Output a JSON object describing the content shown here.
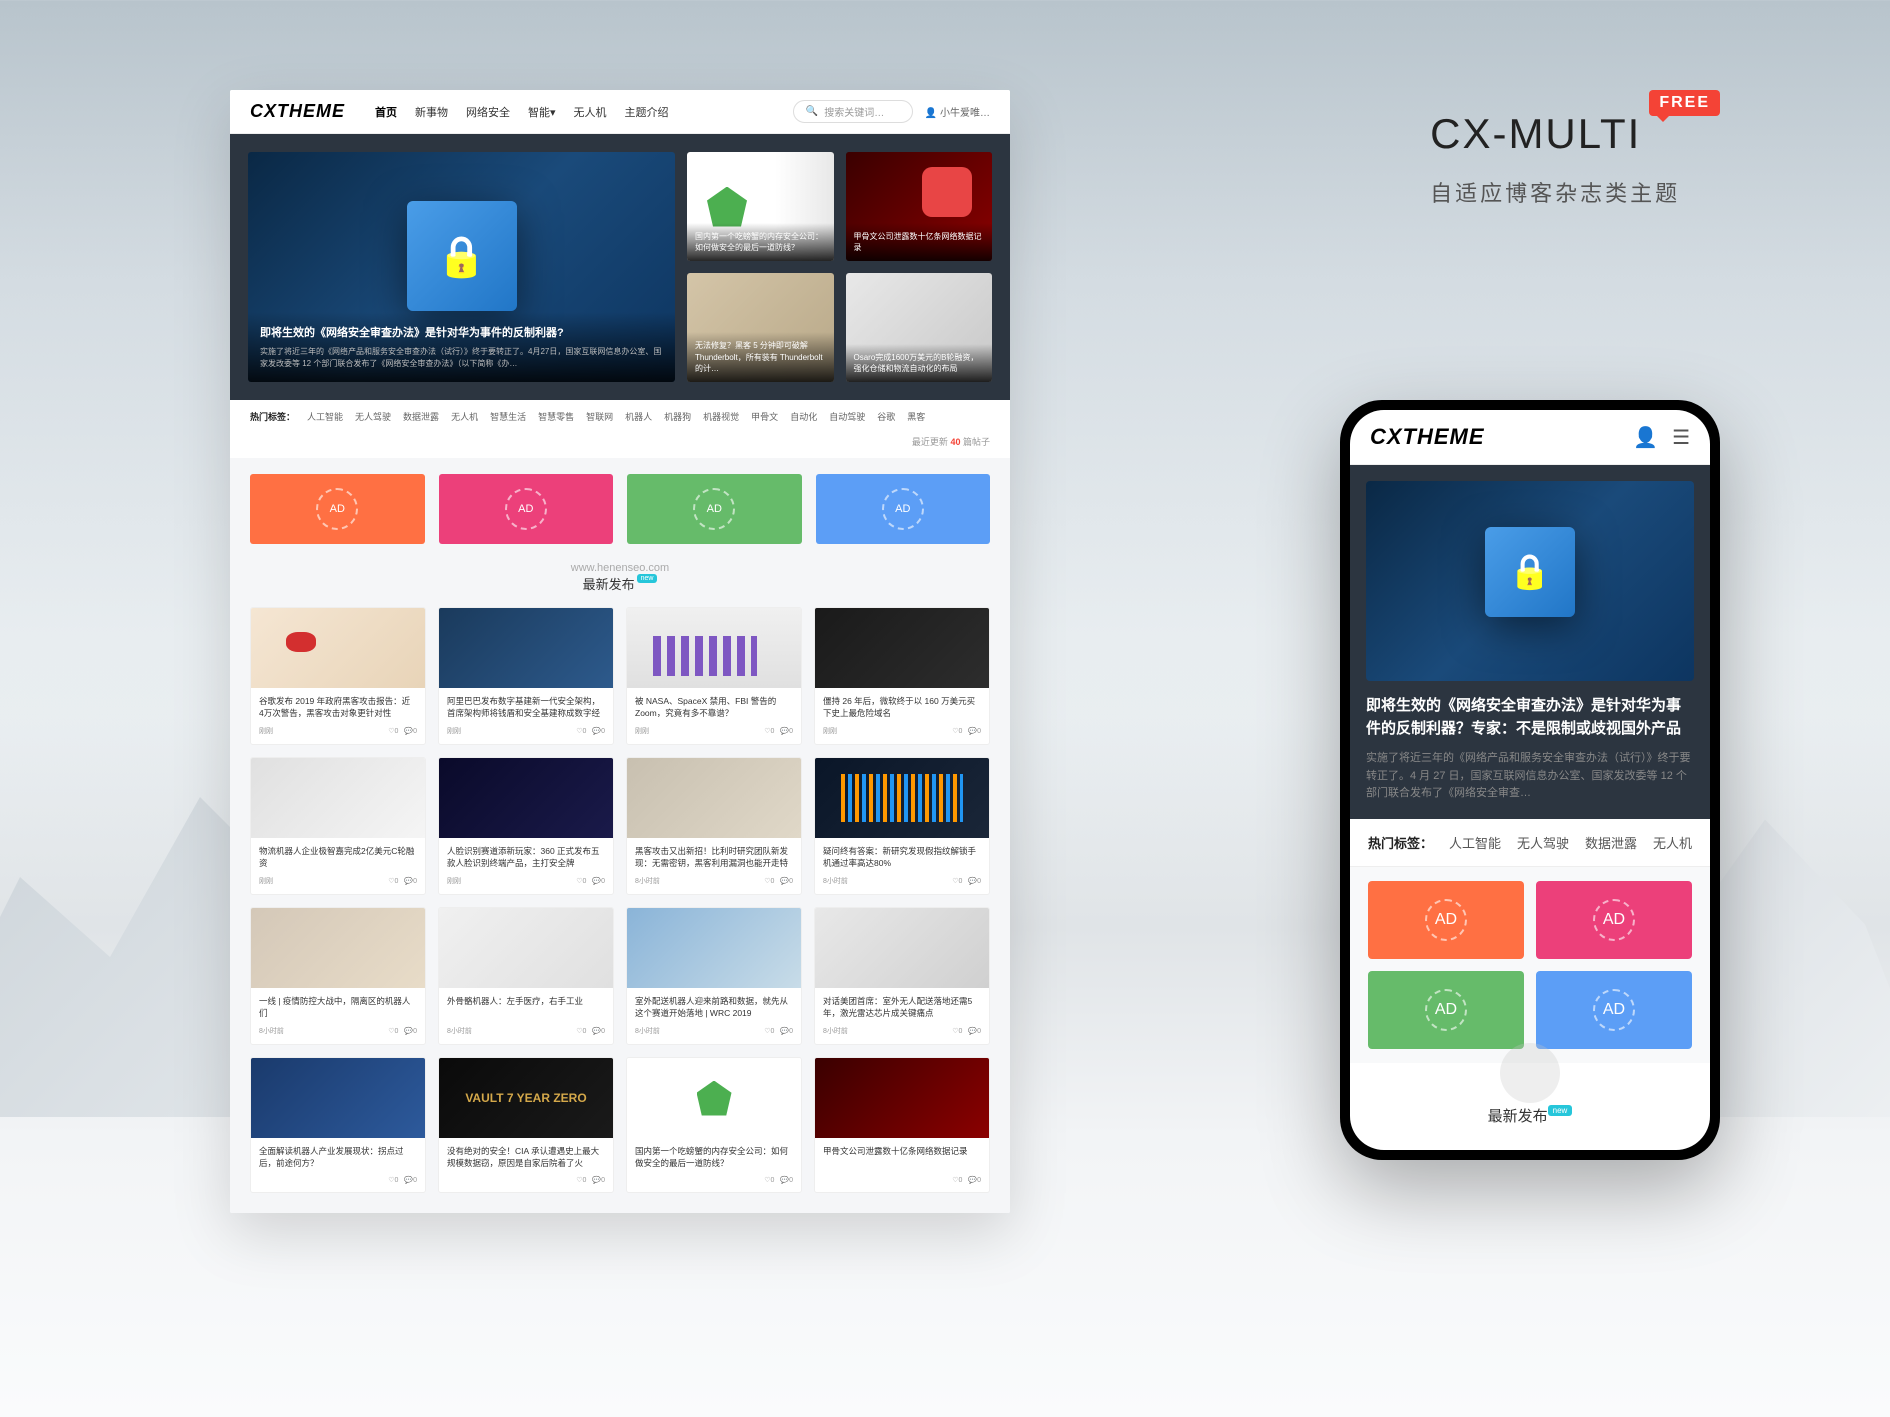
{
  "promo": {
    "title": "CX-MULTI",
    "badge": "FREE",
    "subtitle": "自适应博客杂志类主题"
  },
  "desktop": {
    "logo": "CXTHEME",
    "nav": [
      "首页",
      "新事物",
      "网络安全",
      "智能▾",
      "无人机",
      "主题介绍"
    ],
    "search_placeholder": "搜索关键词…",
    "user": "👤 小牛爱唯…",
    "hero_main": {
      "title": "即将生效的《网络安全审查办法》是针对华为事件的反制利器?",
      "desc": "实施了将近三年的《网络产品和服务安全审查办法（试行）》终于要转正了。4月27日，国家互联网信息办公室、国家发改委等 12 个部门联合发布了《网络安全审查办法》（以下简称《办…"
    },
    "hero_side": [
      {
        "title": "国内第一个吃螃蟹的内存安全公司：如何做安全的最后一道防线？"
      },
      {
        "title": "甲骨文公司泄露数十亿条网络数据记录"
      },
      {
        "title": "无法修复？黑客 5 分钟即可破解 Thunderbolt，所有装有 Thunderbolt 的计…"
      },
      {
        "title": "Osaro完成1600万美元的B轮融资，强化仓储和物流自动化的布局"
      }
    ],
    "tags_label": "热门标签：",
    "tags": [
      "人工智能",
      "无人驾驶",
      "数据泄露",
      "无人机",
      "智慧生活",
      "智慧零售",
      "智联网",
      "机器人",
      "机器狗",
      "机器视觉",
      "甲骨文",
      "自动化",
      "自动驾驶",
      "谷歌",
      "黑客"
    ],
    "update_text": "最近更新",
    "update_count": "40",
    "update_suffix": "篇帖子",
    "ad_label": "AD",
    "section_title": "最新发布",
    "section_badge": "new",
    "watermark": "www.henenseo.com",
    "cards": [
      {
        "title": "谷歌发布 2019 年政府黑客攻击报告：近 4万次警告，黑客攻击对象更针对性",
        "time": "刚刚",
        "img": "ci-map"
      },
      {
        "title": "阿里巴巴发布数字基建新一代安全架构，首席架构师将钱盾和安全基建称成数字经济标配",
        "time": "刚刚",
        "img": "ci-blue"
      },
      {
        "title": "被 NASA、SpaceX 禁用、FBI 警告的 Zoom，究竟有多不靠谱？",
        "time": "刚刚",
        "img": "ci-chart"
      },
      {
        "title": "僵持 26 年后，微软终于以 160 万美元买下史上最危险域名",
        "time": "刚刚",
        "img": "ci-dark"
      },
      {
        "title": "物流机器人企业极智嘉完成2亿美元C轮融资",
        "time": "刚刚",
        "img": "ci-tech"
      },
      {
        "title": "人脸识别赛道添新玩家：360 正式发布五款人脸识别终端产品，主打安全牌",
        "time": "刚刚",
        "img": "ci-face"
      },
      {
        "title": "黑客攻击又出新招！比利时研究团队新发现：无需密钥，黑客利用漏洞也能开走特斯拉…",
        "time": "8小时前",
        "img": "ci-laptop"
      },
      {
        "title": "疑问终有答案：新研究发现假指纹解锁手机通过率高达80%",
        "time": "8小时前",
        "img": "ci-bars"
      },
      {
        "title": "一线 | 疫情防控大战中，隔离区的机器人们",
        "time": "8小时前",
        "img": "ci-room"
      },
      {
        "title": "外骨骼机器人：左手医疗，右手工业",
        "time": "8小时前",
        "img": "ci-sit"
      },
      {
        "title": "室外配送机器人迎来前路和数据，就先从这个赛道开始落地 | WRC 2019",
        "time": "8小时前",
        "img": "ci-outdoor"
      },
      {
        "title": "对话美团首席：室外无人配送落地还需5年，激光雷达芯片成关键痛点",
        "time": "8小时前",
        "img": "ci-robot2"
      },
      {
        "title": "全面解读机器人产业发展现状：拐点过后，前途何方？",
        "time": "",
        "img": "ci-stage"
      },
      {
        "title": "没有绝对的安全！CIA 承认遭遇史上最大规模数据窃，原因是自家后院着了火",
        "time": "",
        "img": "ci-vault",
        "vault": "VAULT 7\nYEAR ZERO"
      },
      {
        "title": "国内第一个吃螃蟹的内存安全公司：如何做安全的最后一道防线？",
        "time": "",
        "img": "ci-anxin2"
      },
      {
        "title": "甲骨文公司泄露数十亿条网络数据记录",
        "time": "",
        "img": "ci-oracle2"
      }
    ],
    "like_label": "♡0",
    "comment_label": "💬0"
  },
  "phone": {
    "logo": "CXTHEME",
    "hero_title": "即将生效的《网络安全审查办法》是针对华为事件的反制利器？专家：不是限制或歧视国外产品",
    "hero_desc": "实施了将近三年的《网络产品和服务安全审查办法（试行）》终于要转正了。4 月 27 日，国家互联网信息办公室、国家发改委等 12 个部门联合发布了《网络安全审查…",
    "tags_label": "热门标签：",
    "tags": [
      "人工智能",
      "无人驾驶",
      "数据泄露",
      "无人机"
    ],
    "ad_label": "AD",
    "section_title": "最新发布",
    "section_badge": "new"
  }
}
